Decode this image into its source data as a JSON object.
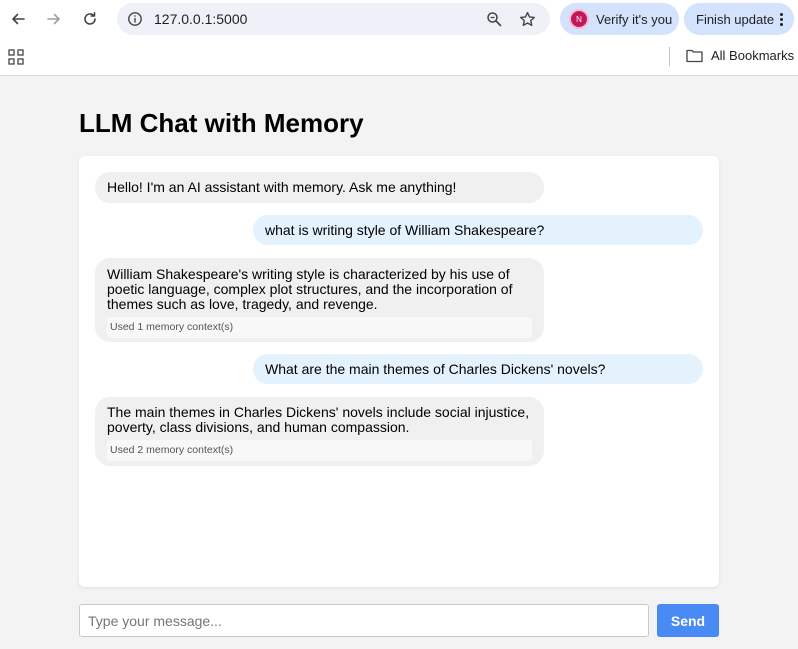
{
  "browser": {
    "url": "127.0.0.1:5000",
    "profile_initial": "N",
    "verify_label": "Verify it's you",
    "update_label": "Finish update",
    "all_bookmarks": "All Bookmarks",
    "colors": {
      "pill": "#d3e3fd",
      "omnibox": "#eef1f8"
    }
  },
  "page": {
    "title": "LLM Chat with Memory"
  },
  "messages": [
    {
      "role": "bot",
      "text": "Hello! I'm an AI assistant with memory. Ask me anything!"
    },
    {
      "role": "user",
      "text": "what is writing style of William Shakespeare?"
    },
    {
      "role": "bot",
      "text": "William Shakespeare's writing style is characterized by his use of poetic language, complex plot structures, and the incorporation of themes such as love, tragedy, and revenge.",
      "memory": "Used 1 memory context(s)"
    },
    {
      "role": "user",
      "text": "What are the main themes of Charles Dickens' novels?"
    },
    {
      "role": "bot",
      "text": "The main themes in Charles Dickens' novels include social injustice, poverty, class divisions, and human compassion.",
      "memory": "Used 2 memory context(s)"
    }
  ],
  "composer": {
    "placeholder": "Type your message...",
    "send_label": "Send",
    "send_color": "#4a8af4"
  }
}
